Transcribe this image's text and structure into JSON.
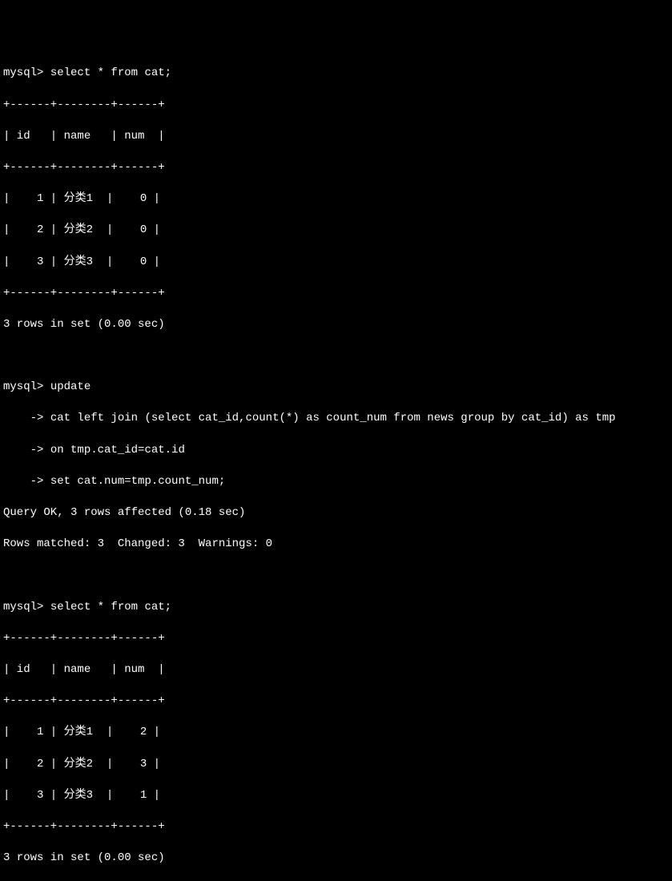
{
  "prompt": "mysql>",
  "continuation": "    ->",
  "query1": {
    "command": " select * from cat;",
    "border": "+------+--------+------+",
    "header": "| id   | name   | num  |",
    "rows": [
      "|    1 | 分类1  |    0 |",
      "|    2 | 分类2  |    0 |",
      "|    3 | 分类3  |    0 |"
    ],
    "footer": "3 rows in set (0.00 sec)"
  },
  "query2": {
    "line1": " update",
    "line2": " cat left join (select cat_id,count(*) as count_num from news group by cat_id) as tmp",
    "line3": " on tmp.cat_id=cat.id",
    "line4": " set cat.num=tmp.count_num;",
    "result1": "Query OK, 3 rows affected (0.18 sec)",
    "result2": "Rows matched: 3  Changed: 3  Warnings: 0"
  },
  "query3": {
    "command": " select * from cat;",
    "border": "+------+--------+------+",
    "header": "| id   | name   | num  |",
    "rows": [
      "|    1 | 分类1  |    2 |",
      "|    2 | 分类2  |    3 |",
      "|    3 | 分类3  |    1 |"
    ],
    "footer": "3 rows in set (0.00 sec)"
  }
}
